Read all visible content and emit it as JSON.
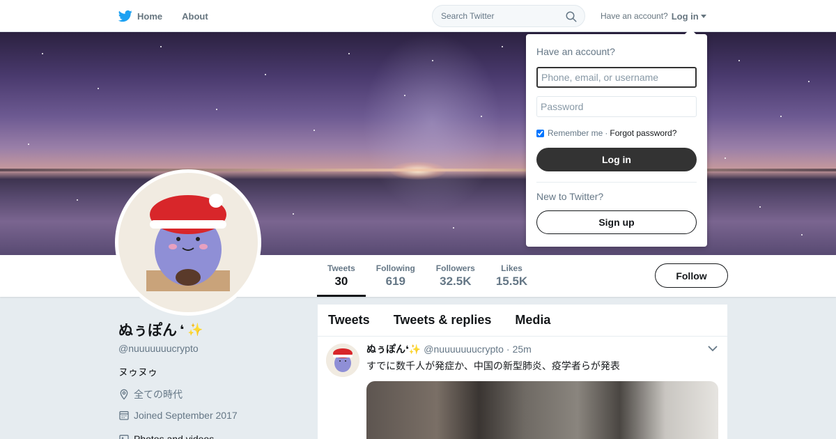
{
  "nav": {
    "home_label": "Home",
    "about_label": "About",
    "search_placeholder": "Search Twitter",
    "have_account": "Have an account?",
    "login_label": "Log in",
    "brand_color": "#1da1f2"
  },
  "profile": {
    "display_name": "ぬぅぽん",
    "name_emojis": "❛ ✨",
    "handle": "@nuuuuuuucrypto",
    "bio": "ヌゥヌゥ",
    "location": "全ての時代",
    "joined": "Joined September 2017",
    "photos_label": "Photos and videos",
    "follow_label": "Follow"
  },
  "stats": [
    {
      "label": "Tweets",
      "value": "30"
    },
    {
      "label": "Following",
      "value": "619"
    },
    {
      "label": "Followers",
      "value": "32.5K"
    },
    {
      "label": "Likes",
      "value": "15.5K"
    }
  ],
  "timeline": {
    "tabs": [
      "Tweets",
      "Tweets & replies",
      "Media"
    ],
    "tweet": {
      "name": "ぬぅぽん❛✨",
      "handle": "@nuuuuuuucrypto",
      "dot": "·",
      "time": "25m",
      "text": "すでに数千人が発症か、中国の新型肺炎、疫学者らが発表"
    }
  },
  "login_menu": {
    "title": "Have an account?",
    "username_placeholder": "Phone, email, or username",
    "password_placeholder": "Password",
    "remember_label": "Remember me",
    "separator": "·",
    "forgot_label": "Forgot password?",
    "login_button": "Log in",
    "new_label": "New to Twitter?",
    "signup_button": "Sign up"
  }
}
